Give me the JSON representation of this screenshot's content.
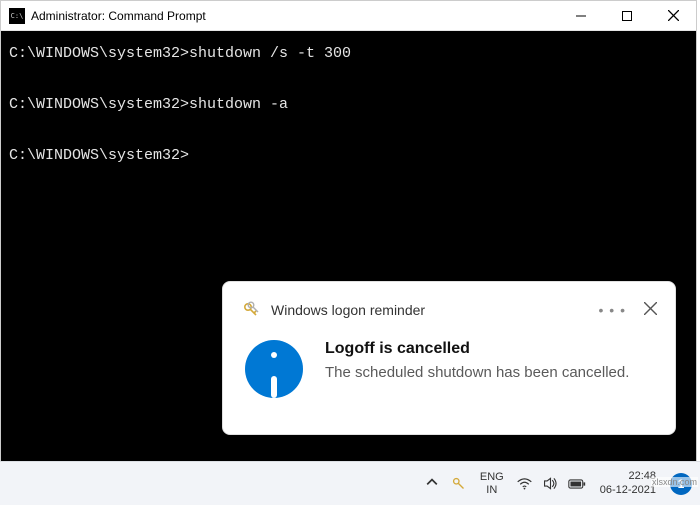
{
  "window": {
    "title": "Administrator: Command Prompt"
  },
  "terminal": {
    "line1": "C:\\WINDOWS\\system32>shutdown /s -t 300",
    "line2": "C:\\WINDOWS\\system32>shutdown -a",
    "line3": "C:\\WINDOWS\\system32>"
  },
  "notification": {
    "app_name": "Windows logon reminder",
    "title": "Logoff is cancelled",
    "body": "The scheduled shutdown has been cancelled."
  },
  "taskbar": {
    "lang_primary": "ENG",
    "lang_secondary": "IN",
    "time": "22:48",
    "date": "06-12-2021",
    "badge_count": "1"
  },
  "watermark": "xlsxdn.com"
}
